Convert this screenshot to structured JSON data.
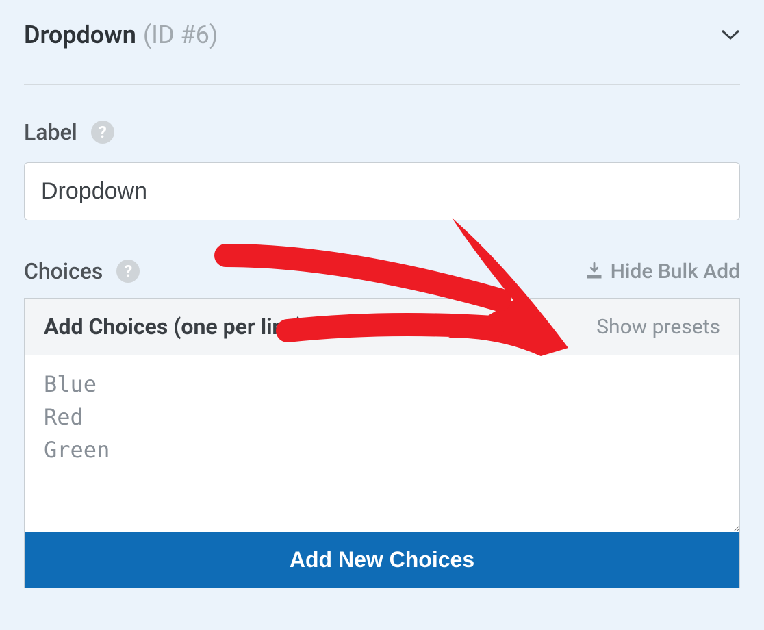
{
  "header": {
    "title": "Dropdown",
    "id_text": "(ID #6)"
  },
  "label_section": {
    "title": "Label",
    "value": "Dropdown"
  },
  "choices_section": {
    "title": "Choices",
    "bulk_toggle": "Hide Bulk Add",
    "bulk_panel": {
      "heading": "Add Choices (one per line)",
      "presets_link": "Show presets",
      "placeholder": "Blue\nRed\nGreen",
      "button": "Add New Choices"
    }
  }
}
